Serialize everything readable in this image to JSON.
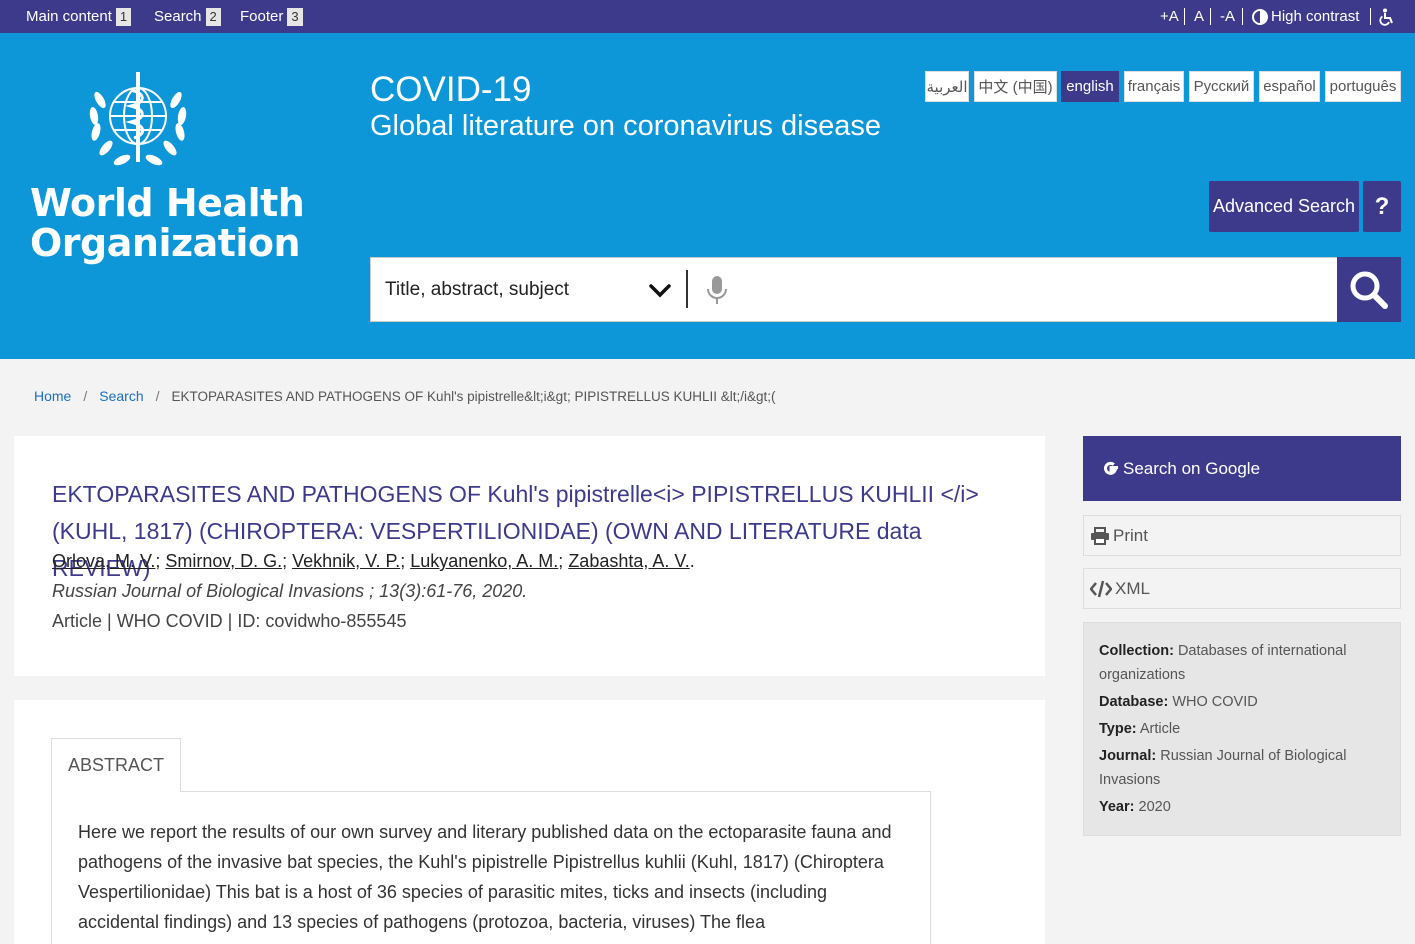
{
  "topbar": {
    "skip_links": [
      {
        "label": "Main content",
        "num": "1"
      },
      {
        "label": "Search",
        "num": "2"
      },
      {
        "label": "Footer",
        "num": "3"
      }
    ],
    "font_increase": "+A",
    "font_reset": "A",
    "font_decrease": "-A",
    "high_contrast": "High contrast"
  },
  "header": {
    "org_name_line1": "World Health",
    "org_name_line2": "Organization",
    "title": "COVID-19",
    "subtitle": "Global literature on coronavirus disease",
    "languages": [
      "العربية",
      "中文 (中国)",
      "english",
      "français",
      "Русский",
      "español",
      "português"
    ],
    "active_language": "english",
    "advanced_search": "Advanced Search",
    "help": "?"
  },
  "search": {
    "field_select": "Title, abstract, subject"
  },
  "breadcrumb": {
    "home": "Home",
    "search": "Search",
    "current": "EKTOPARASITES AND PATHOGENS OF Kuhl's pipistrelle&lt;i&gt; PIPISTRELLUS KUHLII &lt;/i&gt;("
  },
  "record": {
    "title": "EKTOPARASITES AND PATHOGENS OF Kuhl's pipistrelle<i> PIPISTRELLUS KUHLII </i>(KUHL, 1817) (CHIROPTERA: VESPERTILIONIDAE) (OWN AND LITERATURE data REVIEW)",
    "authors": [
      "Orlova, M. V.",
      "Smirnov, D. G.",
      "Vekhnik, V. P.",
      "Lukyanenko, A. M.",
      "Zabashta, A. V."
    ],
    "journal": "Russian Journal of Biological Invasions ; 13(3):61-76, 2020.",
    "meta": "Article | WHO COVID | ID: covidwho-855545"
  },
  "abstract": {
    "tab_label": "ABSTRACT",
    "text": "Here we report the results of our own survey and literary published data on the ectoparasite fauna and pathogens of the invasive bat species, the Kuhl's pipistrelle Pipistrellus kuhlii (Kuhl, 1817) (Chiroptera Vespertilionidae) This bat is a host of 36 species of parasitic mites, ticks and insects (including accidental findings) and 13 species of pathogens (protozoa, bacteria, viruses) The flea"
  },
  "sidebar": {
    "google": "Search on Google",
    "print": "Print",
    "xml": "XML",
    "info": {
      "collection_label": "Collection:",
      "collection": "Databases of international organizations",
      "database_label": "Database:",
      "database": "WHO COVID",
      "type_label": "Type:",
      "type": "Article",
      "journal_label": "Journal:",
      "journal": "Russian Journal of Biological Invasions",
      "year_label": "Year:",
      "year": "2020"
    }
  },
  "colors": {
    "header_blue": "#0d96d8",
    "brand_purple": "#3d3a8c"
  }
}
